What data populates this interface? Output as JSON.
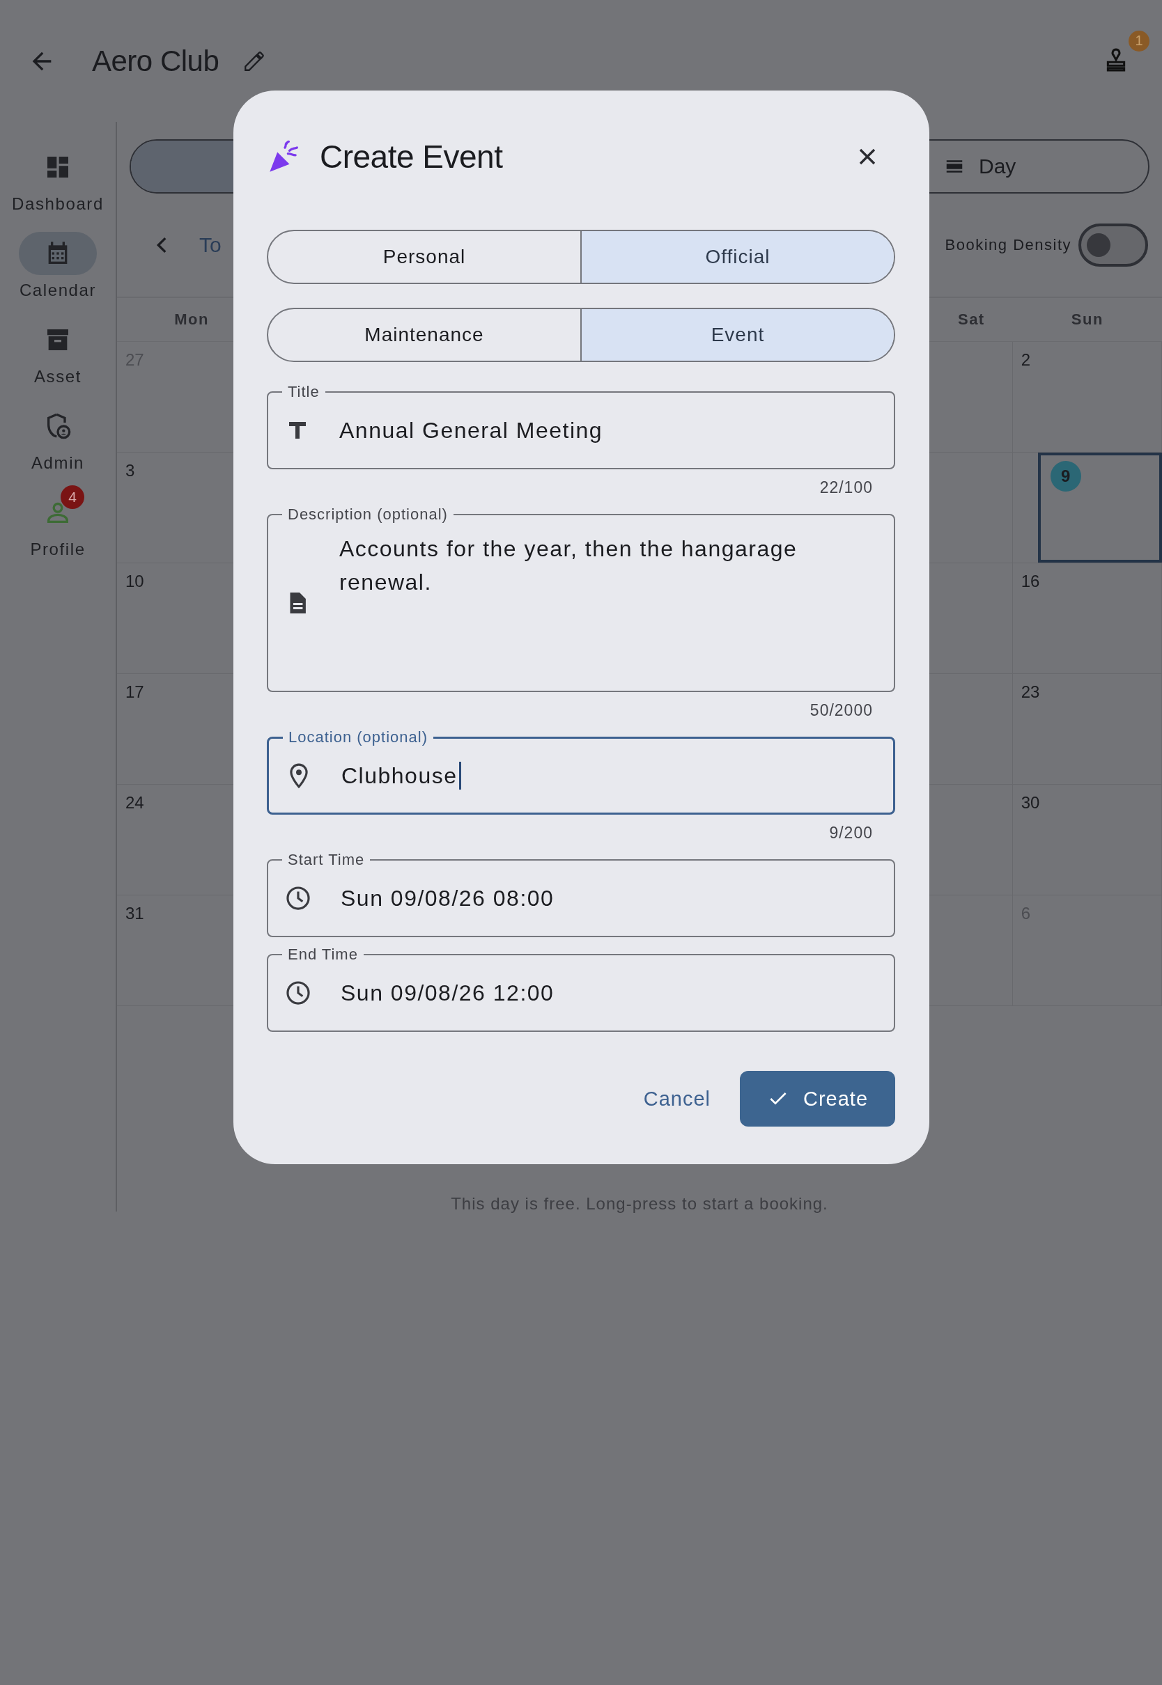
{
  "header": {
    "title": "Aero Club",
    "notification_count": "1"
  },
  "sidebar": {
    "items": [
      {
        "kind": "dashboard",
        "label": "Dashboard",
        "selected": false
      },
      {
        "kind": "calendar",
        "label": "Calendar",
        "selected": true
      },
      {
        "kind": "asset",
        "label": "Asset",
        "selected": false
      },
      {
        "kind": "admin",
        "label": "Admin",
        "selected": false
      },
      {
        "kind": "profile",
        "label": "Profile",
        "selected": false,
        "badge": "4"
      }
    ]
  },
  "view_switch": {
    "segments": [
      {
        "label": "Day",
        "selected": false
      }
    ]
  },
  "toolbar": {
    "today_label": "To",
    "density_label": "Booking Density",
    "density_on": false
  },
  "calendar": {
    "weekdays": {
      "mon": "Mon",
      "sat": "Sat",
      "sun": "Sun"
    },
    "weeks": [
      {
        "mon": {
          "label": "27",
          "outside_month": true,
          "today": false
        },
        "sun": {
          "label": "2",
          "outside_month": false,
          "today": false
        }
      },
      {
        "mon": {
          "label": "3",
          "outside_month": false,
          "today": false
        },
        "sun": {
          "label": "9",
          "outside_month": false,
          "today": true
        }
      },
      {
        "mon": {
          "label": "10",
          "outside_month": false,
          "today": false
        },
        "sun": {
          "label": "16",
          "outside_month": false,
          "today": false
        }
      },
      {
        "mon": {
          "label": "17",
          "outside_month": false,
          "today": false
        },
        "sun": {
          "label": "23",
          "outside_month": false,
          "today": false
        }
      },
      {
        "mon": {
          "label": "24",
          "outside_month": false,
          "today": false
        },
        "sun": {
          "label": "30",
          "outside_month": false,
          "today": false
        }
      },
      {
        "mon": {
          "label": "31",
          "outside_month": false,
          "today": false
        },
        "sun": {
          "label": "6",
          "outside_month": true,
          "today": false
        }
      }
    ],
    "empty_message": "This day is free. Long-press to start a booking."
  },
  "dialog": {
    "title": "Create Event",
    "visibility": [
      {
        "label": "Personal",
        "selected": false
      },
      {
        "label": "Official",
        "selected": true
      }
    ],
    "category": [
      {
        "label": "Maintenance",
        "selected": false
      },
      {
        "label": "Event",
        "selected": true
      }
    ],
    "fields": [
      {
        "kind": "title",
        "label": "Title",
        "value": "Annual General Meeting",
        "counter": "22/100",
        "focused": false
      },
      {
        "kind": "description",
        "label": "Description (optional)",
        "value": "Accounts for the year, then the hangarage renewal.",
        "counter": "50/2000",
        "focused": false
      },
      {
        "kind": "location",
        "label": "Location (optional)",
        "value": "Clubhouse",
        "counter": "9/200",
        "focused": true
      },
      {
        "kind": "time",
        "label": "Start Time",
        "value": "Sun 09/08/26 08:00",
        "focused": false
      },
      {
        "kind": "time",
        "label": "End Time",
        "value": "Sun 09/08/26 12:00",
        "focused": false
      }
    ],
    "actions": {
      "cancel": "Cancel",
      "confirm": "Create"
    }
  }
}
